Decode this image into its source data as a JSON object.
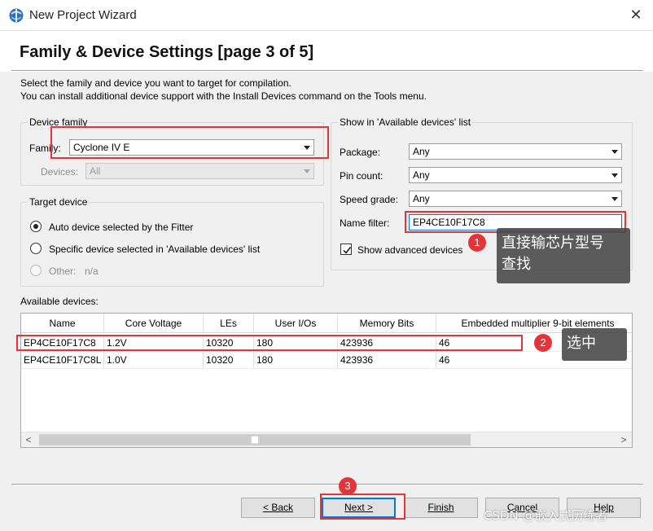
{
  "window": {
    "title": "New Project Wizard",
    "close_glyph": "✕"
  },
  "header": {
    "page_title": "Family & Device Settings [page 3 of 5]"
  },
  "intro": {
    "line1": "Select the family and device you want to target for compilation.",
    "line2": "You can install additional device support with the Install Devices command on the Tools menu."
  },
  "device_family": {
    "legend": "Device family",
    "family_label": "Family:",
    "family_value": "Cyclone IV E",
    "devices_label": "Devices:",
    "devices_value": "All"
  },
  "target_device": {
    "legend": "Target device",
    "auto_label": "Auto device selected by the Fitter",
    "specific_label": "Specific device selected in 'Available devices' list",
    "other_label": "Other:",
    "other_value": "n/a",
    "selected": "auto"
  },
  "show_in": {
    "legend": "Show in 'Available devices' list",
    "package_label": "Package:",
    "package_value": "Any",
    "pin_count_label": "Pin count:",
    "pin_count_value": "Any",
    "speed_grade_label": "Speed grade:",
    "speed_grade_value": "Any",
    "name_filter_label": "Name filter:",
    "name_filter_value": "EP4CE10F17C8",
    "show_advanced_label": "Show advanced devices",
    "show_advanced_checked": true
  },
  "available": {
    "label": "Available devices:",
    "columns": [
      "Name",
      "Core Voltage",
      "LEs",
      "User I/Os",
      "Memory Bits",
      "Embedded multiplier 9-bit elements"
    ],
    "rows": [
      [
        "EP4CE10F17C8",
        "1.2V",
        "10320",
        "180",
        "423936",
        "46"
      ],
      [
        "EP4CE10F17C8L",
        "1.0V",
        "10320",
        "180",
        "423936",
        "46"
      ]
    ],
    "scroll_left": "<",
    "scroll_right": ">"
  },
  "buttons": {
    "back": "< Back",
    "next": "Next >",
    "finish": "Finish",
    "cancel": "Cancel",
    "help": "Help"
  },
  "annotations": {
    "badge1": "1",
    "callout1_line1": "直接输芯片型号",
    "callout1_line2": "查找",
    "badge2": "2",
    "callout2": "选中",
    "badge3": "3",
    "accent_color": "#e3343a"
  },
  "watermark": "CSDN @嵌入式历练者"
}
